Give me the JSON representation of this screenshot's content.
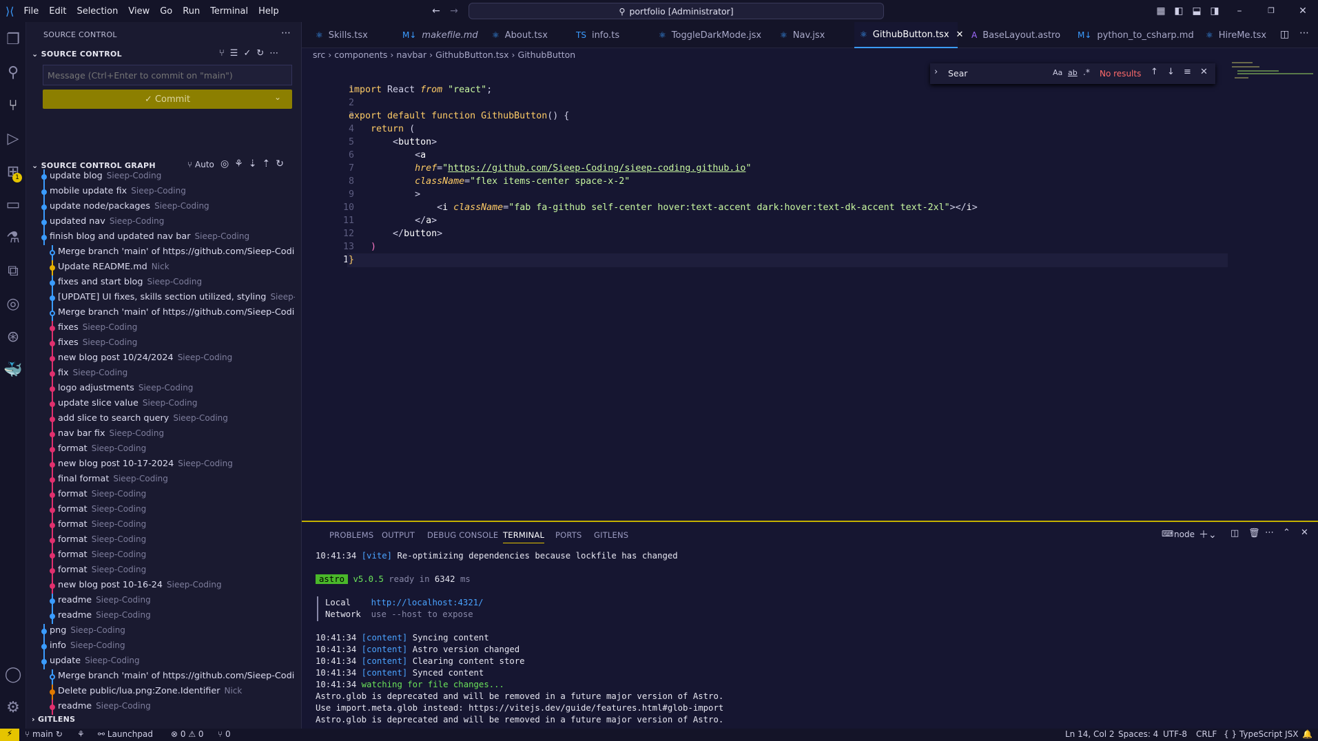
{
  "menu": [
    "File",
    "Edit",
    "Selection",
    "View",
    "Go",
    "Run",
    "Terminal",
    "Help"
  ],
  "command_center": "portfolio [Administrator]",
  "sidebar": {
    "title": "SOURCE CONTROL",
    "section": "SOURCE CONTROL",
    "commit_placeholder": "Message (Ctrl+Enter to commit on \"main\")",
    "commit_button": "✓ Commit",
    "graph_title": "SOURCE CONTROL GRAPH",
    "graph_auto": "Auto",
    "gitlens": "GITLENS",
    "commits": [
      {
        "msg": "update blog",
        "author": "Sieep-Coding",
        "color": "#3b9cff",
        "indent": 0
      },
      {
        "msg": "mobile update fix",
        "author": "Sieep-Coding",
        "color": "#3b9cff",
        "indent": 0
      },
      {
        "msg": "update node/packages",
        "author": "Sieep-Coding",
        "color": "#3b9cff",
        "indent": 0
      },
      {
        "msg": "updated nav",
        "author": "Sieep-Coding",
        "color": "#3b9cff",
        "indent": 0
      },
      {
        "msg": "finish blog and updated nav bar",
        "author": "Sieep-Coding",
        "color": "#3b9cff",
        "indent": 0
      },
      {
        "msg": "Merge branch 'main' of https://github.com/Sieep-Coding...",
        "author": "",
        "color": "#3b9cff",
        "indent": 1,
        "merge": true
      },
      {
        "msg": "Update README.md",
        "author": "Nick",
        "color": "#e5b000",
        "indent": 1
      },
      {
        "msg": "fixes and start blog",
        "author": "Sieep-Coding",
        "color": "#3b9cff",
        "indent": 1
      },
      {
        "msg": "[UPDATE] UI fixes, skills section utilized, styling",
        "author": "Sieep-Codi...",
        "color": "#3b9cff",
        "indent": 1
      },
      {
        "msg": "Merge branch 'main' of https://github.com/Sieep-Coding...",
        "author": "",
        "color": "#3b9cff",
        "indent": 1,
        "merge": true
      },
      {
        "msg": "fixes",
        "author": "Sieep-Coding",
        "color": "#e0306e",
        "indent": 1
      },
      {
        "msg": "fixes",
        "author": "Sieep-Coding",
        "color": "#e0306e",
        "indent": 1
      },
      {
        "msg": "new blog post 10/24/2024",
        "author": "Sieep-Coding",
        "color": "#e0306e",
        "indent": 1
      },
      {
        "msg": "fix",
        "author": "Sieep-Coding",
        "color": "#e0306e",
        "indent": 1
      },
      {
        "msg": "logo adjustments",
        "author": "Sieep-Coding",
        "color": "#e0306e",
        "indent": 1
      },
      {
        "msg": "update slice value",
        "author": "Sieep-Coding",
        "color": "#e0306e",
        "indent": 1
      },
      {
        "msg": "add slice to search query",
        "author": "Sieep-Coding",
        "color": "#e0306e",
        "indent": 1
      },
      {
        "msg": "nav bar fix",
        "author": "Sieep-Coding",
        "color": "#e0306e",
        "indent": 1
      },
      {
        "msg": "format",
        "author": "Sieep-Coding",
        "color": "#e0306e",
        "indent": 1
      },
      {
        "msg": "new blog post 10-17-2024",
        "author": "Sieep-Coding",
        "color": "#e0306e",
        "indent": 1
      },
      {
        "msg": "final format",
        "author": "Sieep-Coding",
        "color": "#e0306e",
        "indent": 1
      },
      {
        "msg": "format",
        "author": "Sieep-Coding",
        "color": "#e0306e",
        "indent": 1
      },
      {
        "msg": "format",
        "author": "Sieep-Coding",
        "color": "#e0306e",
        "indent": 1
      },
      {
        "msg": "format",
        "author": "Sieep-Coding",
        "color": "#e0306e",
        "indent": 1
      },
      {
        "msg": "format",
        "author": "Sieep-Coding",
        "color": "#e0306e",
        "indent": 1
      },
      {
        "msg": "format",
        "author": "Sieep-Coding",
        "color": "#e0306e",
        "indent": 1
      },
      {
        "msg": "format",
        "author": "Sieep-Coding",
        "color": "#e0306e",
        "indent": 1
      },
      {
        "msg": "new blog post 10-16-24",
        "author": "Sieep-Coding",
        "color": "#e0306e",
        "indent": 1
      },
      {
        "msg": "readme",
        "author": "Sieep-Coding",
        "color": "#3b9cff",
        "indent": 1
      },
      {
        "msg": "readme",
        "author": "Sieep-Coding",
        "color": "#3b9cff",
        "indent": 1
      },
      {
        "msg": "png",
        "author": "Sieep-Coding",
        "color": "#3b9cff",
        "indent": 0
      },
      {
        "msg": "info",
        "author": "Sieep-Coding",
        "color": "#3b9cff",
        "indent": 0
      },
      {
        "msg": "update",
        "author": "Sieep-Coding",
        "color": "#3b9cff",
        "indent": 0
      },
      {
        "msg": "Merge branch 'main' of https://github.com/Sieep-Coding...",
        "author": "",
        "color": "#3b9cff",
        "indent": 1,
        "merge": true
      },
      {
        "msg": "Delete public/lua.png:Zone.Identifier",
        "author": "Nick",
        "color": "#e07a00",
        "indent": 1
      },
      {
        "msg": "readme",
        "author": "Sieep-Coding",
        "color": "#e0306e",
        "indent": 1
      }
    ]
  },
  "tabs": [
    {
      "label": "Skills.tsx",
      "icon": "⚛",
      "iconColor": "#3b9cff"
    },
    {
      "label": "makefile.md",
      "icon": "M↓",
      "iconColor": "#3b9cff",
      "italic": true
    },
    {
      "label": "About.tsx",
      "icon": "⚛",
      "iconColor": "#3b9cff"
    },
    {
      "label": "info.ts",
      "icon": "TS",
      "iconColor": "#3b9cff"
    },
    {
      "label": "ToggleDarkMode.jsx",
      "icon": "⚛",
      "iconColor": "#3b9cff"
    },
    {
      "label": "Nav.jsx",
      "icon": "⚛",
      "iconColor": "#3b9cff"
    },
    {
      "label": "GithubButton.tsx",
      "icon": "⚛",
      "iconColor": "#3b9cff",
      "active": true
    },
    {
      "label": "BaseLayout.astro",
      "icon": "A",
      "iconColor": "#a06bff"
    },
    {
      "label": "python_to_csharp.md",
      "icon": "M↓",
      "iconColor": "#3b9cff"
    },
    {
      "label": "HireMe.tsx",
      "icon": "⚛",
      "iconColor": "#3b9cff"
    }
  ],
  "breadcrumb": [
    "src",
    "components",
    "navbar",
    "GithubButton.tsx",
    "GithubButton"
  ],
  "find": {
    "value": "Sear",
    "case": "Aa",
    "word": "ab",
    "regex": ".*",
    "result": "No results"
  },
  "code": {
    "line_numbers": [
      "1",
      "2",
      "3",
      "4",
      "5",
      "6",
      "7",
      "8",
      "9",
      "10",
      "11",
      "12",
      "13",
      "14"
    ]
  },
  "panel": {
    "tabs": [
      "PROBLEMS",
      "OUTPUT",
      "DEBUG CONSOLE",
      "TERMINAL",
      "PORTS",
      "GITLENS"
    ],
    "active_tab": "TERMINAL",
    "shell": "node",
    "lines": {
      "l1_time": "10:41:34",
      "l1_tag": "[vite]",
      "l1_msg": "Re-optimizing dependencies because lockfile has changed",
      "astro_badge": "astro",
      "astro_ver": "v5.0.5",
      "astro_ready": "ready in",
      "astro_ms": "6342",
      "astro_unit": "ms",
      "local_label": "Local",
      "local_url": "http://localhost:4321/",
      "network_label": "Network",
      "network_hint": "use --host to expose",
      "c1": "Syncing content",
      "c2": "Astro version changed",
      "c3": "Clearing content store",
      "c4": "Synced content",
      "content_tag": "[content]",
      "time": "10:41:34",
      "watch": "watching for file changes...",
      "w1": "Astro.glob is deprecated and will be removed in a future major version of Astro.",
      "w2": "Use import.meta.glob instead: https://vitejs.dev/guide/features.html#glob-import",
      "w3": "Astro.glob is deprecated and will be removed in a future major version of Astro."
    }
  },
  "status": {
    "branch": "main",
    "launchpad": "Launchpad",
    "errors": "0",
    "warnings": "0",
    "ports": "0",
    "position": "Ln 14, Col 2",
    "spaces": "Spaces: 4",
    "encoding": "UTF-8",
    "eol": "CRLF",
    "language": "TypeScript JSX",
    "extension_badge": "1"
  }
}
